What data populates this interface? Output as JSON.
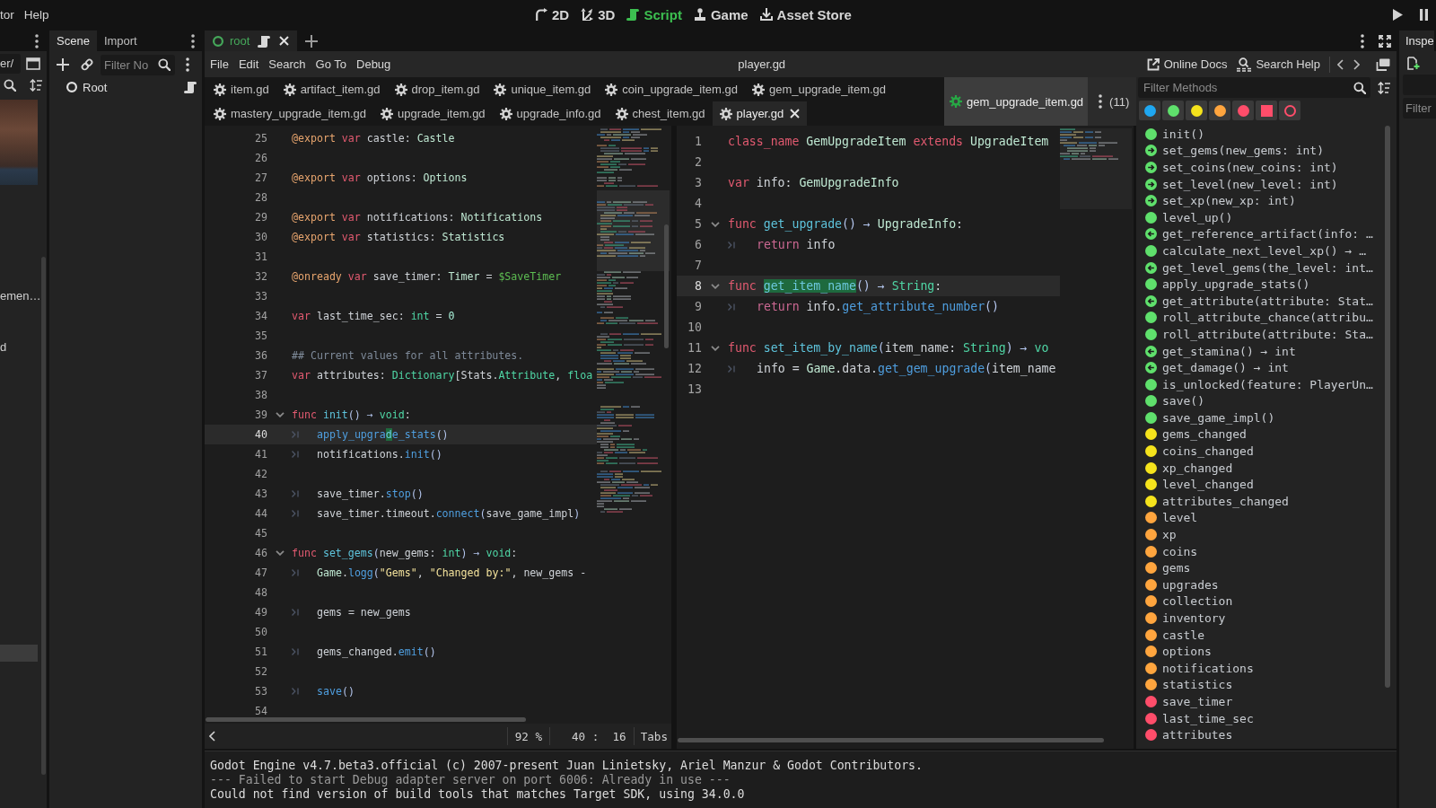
{
  "top_menu": [
    "tor",
    "Help"
  ],
  "workspaces": [
    {
      "label": "2D",
      "kind": "canvas",
      "selected": false
    },
    {
      "label": "3D",
      "kind": "spatial",
      "selected": false
    },
    {
      "label": "Script",
      "kind": "script",
      "selected": true
    },
    {
      "label": "Game",
      "kind": "game",
      "selected": false
    },
    {
      "label": "Asset Store",
      "kind": "store",
      "selected": false
    }
  ],
  "filesystem_dock": {
    "path": "er/",
    "items": [
      {
        "label": "emen…",
        "selected": false
      },
      {
        "label": "d",
        "selected": false
      },
      {
        "selected": true
      }
    ]
  },
  "scene_dock": {
    "tabs": [
      {
        "label": "Scene",
        "selected": true
      },
      {
        "label": "Import",
        "selected": false
      }
    ],
    "filter": {
      "placeholder": "Filter No"
    },
    "tree": [
      {
        "label": "Root",
        "has_script": true
      }
    ]
  },
  "script_editor": {
    "scene_tabs": [
      {
        "label": "root",
        "selected": true
      }
    ],
    "menu": [
      "File",
      "Edit",
      "Search",
      "Go To",
      "Debug"
    ],
    "current_file": "player.gd",
    "help_buttons": [
      {
        "label": "Online Docs",
        "kind": "docs"
      },
      {
        "label": "Search Help",
        "kind": "search"
      }
    ],
    "script_tab_rows": [
      {
        "tabs": [
          {
            "label": "item.gd",
            "selected": false
          },
          {
            "label": "artifact_item.gd",
            "selected": false
          },
          {
            "label": "drop_item.gd",
            "selected": false
          },
          {
            "label": "unique_item.gd",
            "selected": false
          },
          {
            "label": "coin_upgrade_item.gd",
            "selected": false
          },
          {
            "label": "gem_upgrade_item.gd",
            "selected": false
          }
        ]
      },
      {
        "tabs": [
          {
            "label": "mastery_upgrade_item.gd",
            "selected": false
          },
          {
            "label": "upgrade_item.gd",
            "selected": false
          },
          {
            "label": "upgrade_info.gd",
            "selected": false
          },
          {
            "label": "chest_item.gd",
            "selected": false
          },
          {
            "label": "player.gd",
            "selected": true
          }
        ]
      }
    ],
    "split_header": {
      "label": "gem_upgrade_item.gd",
      "count": "(11)"
    },
    "editors": [
      {
        "status": {
          "zoom": "92 %",
          "position": "40 :  16",
          "indentation": "Tabs"
        },
        "lines": [
          {
            "number": "25",
            "foldable": false,
            "indented": false,
            "current": false,
            "tokens": [
              {
                "kind": "annotation",
                "text": "@export "
              },
              {
                "kind": "keyword",
                "text": "var"
              },
              {
                "kind": "plain",
                "text": " castle: "
              },
              {
                "kind": "class",
                "text": "Castle"
              }
            ]
          },
          {
            "number": "26",
            "foldable": false,
            "indented": false,
            "current": false
          },
          {
            "number": "27",
            "foldable": false,
            "indented": false,
            "current": false,
            "tokens": [
              {
                "kind": "annotation",
                "text": "@export "
              },
              {
                "kind": "keyword",
                "text": "var"
              },
              {
                "kind": "plain",
                "text": " options: "
              },
              {
                "kind": "class",
                "text": "Options"
              }
            ]
          },
          {
            "number": "28",
            "foldable": false,
            "indented": false,
            "current": false
          },
          {
            "number": "29",
            "foldable": false,
            "indented": false,
            "current": false,
            "tokens": [
              {
                "kind": "annotation",
                "text": "@export "
              },
              {
                "kind": "keyword",
                "text": "var"
              },
              {
                "kind": "plain",
                "text": " notifications: "
              },
              {
                "kind": "class",
                "text": "Notifications"
              }
            ]
          },
          {
            "number": "30",
            "foldable": false,
            "indented": false,
            "current": false,
            "tokens": [
              {
                "kind": "annotation",
                "text": "@export "
              },
              {
                "kind": "keyword",
                "text": "var"
              },
              {
                "kind": "plain",
                "text": " statistics: "
              },
              {
                "kind": "class",
                "text": "Statistics"
              }
            ]
          },
          {
            "number": "31",
            "foldable": false,
            "indented": false,
            "current": false
          },
          {
            "number": "32",
            "foldable": false,
            "indented": false,
            "current": false,
            "tokens": [
              {
                "kind": "annotation",
                "text": "@onready "
              },
              {
                "kind": "keyword",
                "text": "var"
              },
              {
                "kind": "plain",
                "text": " save_timer: "
              },
              {
                "kind": "class",
                "text": "Timer"
              },
              {
                "kind": "plain",
                "text": " = "
              },
              {
                "kind": "nodepath",
                "text": "$SaveTimer"
              }
            ]
          },
          {
            "number": "33",
            "foldable": false,
            "indented": false,
            "current": false
          },
          {
            "number": "34",
            "foldable": false,
            "indented": false,
            "current": false,
            "tokens": [
              {
                "kind": "keyword",
                "text": "var"
              },
              {
                "kind": "plain",
                "text": " last_time_sec: "
              },
              {
                "kind": "type",
                "text": "int"
              },
              {
                "kind": "plain",
                "text": " = "
              },
              {
                "kind": "number",
                "text": "0"
              }
            ]
          },
          {
            "number": "35",
            "foldable": false,
            "indented": false,
            "current": false
          },
          {
            "number": "36",
            "foldable": false,
            "indented": false,
            "current": false,
            "tokens": [
              {
                "kind": "comment",
                "text": "## Current values for all attributes."
              }
            ]
          },
          {
            "number": "37",
            "foldable": false,
            "indented": false,
            "current": false,
            "tokens": [
              {
                "kind": "keyword",
                "text": "var"
              },
              {
                "kind": "plain",
                "text": " attributes: "
              },
              {
                "kind": "type",
                "text": "Dictionary"
              },
              {
                "kind": "plain",
                "text": "[Stats."
              },
              {
                "kind": "type",
                "text": "Attribute"
              },
              {
                "kind": "plain",
                "text": ", "
              },
              {
                "kind": "type",
                "text": "floa"
              }
            ]
          },
          {
            "number": "38",
            "foldable": false,
            "indented": false,
            "current": false
          },
          {
            "number": "39",
            "foldable": true,
            "indented": false,
            "current": false,
            "tokens": [
              {
                "kind": "keyword",
                "text": "func "
              },
              {
                "kind": "funcdef",
                "text": "init"
              },
              {
                "kind": "symbol",
                "text": "() → "
              },
              {
                "kind": "type",
                "text": "void"
              },
              {
                "kind": "plain",
                "text": ":"
              }
            ]
          },
          {
            "number": "40",
            "foldable": false,
            "indented": true,
            "current": true,
            "tokens": [
              {
                "kind": "call",
                "text": "apply_upgra"
              },
              {
                "kind": "selection",
                "text": "d"
              },
              {
                "kind": "call",
                "text": "e_stats"
              },
              {
                "kind": "symbol",
                "text": "()"
              }
            ]
          },
          {
            "number": "41",
            "foldable": false,
            "indented": true,
            "current": false,
            "tokens": [
              {
                "kind": "plain",
                "text": "notifications."
              },
              {
                "kind": "call",
                "text": "init"
              },
              {
                "kind": "symbol",
                "text": "()"
              }
            ]
          },
          {
            "number": "42",
            "foldable": false,
            "indented": false,
            "current": false
          },
          {
            "number": "43",
            "foldable": false,
            "indented": true,
            "current": false,
            "tokens": [
              {
                "kind": "plain",
                "text": "save_timer."
              },
              {
                "kind": "call",
                "text": "stop"
              },
              {
                "kind": "symbol",
                "text": "()"
              }
            ]
          },
          {
            "number": "44",
            "foldable": false,
            "indented": true,
            "current": false,
            "tokens": [
              {
                "kind": "plain",
                "text": "save_timer.timeout."
              },
              {
                "kind": "call",
                "text": "connect"
              },
              {
                "kind": "symbol",
                "text": "("
              },
              {
                "kind": "plain",
                "text": "save_game_impl"
              },
              {
                "kind": "symbol",
                "text": ")"
              }
            ]
          },
          {
            "number": "45",
            "foldable": false,
            "indented": false,
            "current": false
          },
          {
            "number": "46",
            "foldable": true,
            "indented": false,
            "current": false,
            "tokens": [
              {
                "kind": "keyword",
                "text": "func "
              },
              {
                "kind": "funcdef",
                "text": "set_gems"
              },
              {
                "kind": "symbol",
                "text": "("
              },
              {
                "kind": "plain",
                "text": "new_gems: "
              },
              {
                "kind": "type",
                "text": "int"
              },
              {
                "kind": "symbol",
                "text": ") → "
              },
              {
                "kind": "type",
                "text": "void"
              },
              {
                "kind": "plain",
                "text": ":"
              }
            ]
          },
          {
            "number": "47",
            "foldable": false,
            "indented": true,
            "current": false,
            "tokens": [
              {
                "kind": "class",
                "text": "Game"
              },
              {
                "kind": "plain",
                "text": "."
              },
              {
                "kind": "call",
                "text": "logg"
              },
              {
                "kind": "symbol",
                "text": "("
              },
              {
                "kind": "string",
                "text": "\"Gems\""
              },
              {
                "kind": "plain",
                "text": ", "
              },
              {
                "kind": "string",
                "text": "\"Changed by:\""
              },
              {
                "kind": "plain",
                "text": ", new_gems -"
              }
            ]
          },
          {
            "number": "48",
            "foldable": false,
            "indented": false,
            "current": false
          },
          {
            "number": "49",
            "foldable": false,
            "indented": true,
            "current": false,
            "tokens": [
              {
                "kind": "plain",
                "text": "gems = new_gems"
              }
            ]
          },
          {
            "number": "50",
            "foldable": false,
            "indented": false,
            "current": false
          },
          {
            "number": "51",
            "foldable": false,
            "indented": true,
            "current": false,
            "tokens": [
              {
                "kind": "plain",
                "text": "gems_changed."
              },
              {
                "kind": "call",
                "text": "emit"
              },
              {
                "kind": "symbol",
                "text": "()"
              }
            ]
          },
          {
            "number": "52",
            "foldable": false,
            "indented": false,
            "current": false
          },
          {
            "number": "53",
            "foldable": false,
            "indented": true,
            "current": false,
            "tokens": [
              {
                "kind": "call",
                "text": "save"
              },
              {
                "kind": "symbol",
                "text": "()"
              }
            ]
          },
          {
            "number": "54",
            "foldable": false,
            "indented": false,
            "current": false
          }
        ]
      },
      {
        "lines": [
          {
            "number": "1",
            "foldable": false,
            "indented": false,
            "current": false,
            "tokens": [
              {
                "kind": "keyword",
                "text": "class_name "
              },
              {
                "kind": "class",
                "text": "GemUpgradeItem "
              },
              {
                "kind": "keyword",
                "text": "extends "
              },
              {
                "kind": "class",
                "text": "UpgradeItem"
              }
            ]
          },
          {
            "number": "2",
            "foldable": false,
            "indented": false,
            "current": false
          },
          {
            "number": "3",
            "foldable": false,
            "indented": false,
            "current": false,
            "tokens": [
              {
                "kind": "keyword",
                "text": "var"
              },
              {
                "kind": "plain",
                "text": " info: "
              },
              {
                "kind": "class",
                "text": "GemUpgradeInfo"
              }
            ]
          },
          {
            "number": "4",
            "foldable": false,
            "indented": false,
            "current": false
          },
          {
            "number": "5",
            "foldable": true,
            "indented": false,
            "current": false,
            "tokens": [
              {
                "kind": "keyword",
                "text": "func "
              },
              {
                "kind": "funcdef",
                "text": "get_upgrade"
              },
              {
                "kind": "symbol",
                "text": "() → "
              },
              {
                "kind": "class",
                "text": "UpgradeInfo"
              },
              {
                "kind": "plain",
                "text": ":"
              }
            ]
          },
          {
            "number": "6",
            "foldable": false,
            "indented": true,
            "current": false,
            "tokens": [
              {
                "kind": "control",
                "text": "return"
              },
              {
                "kind": "plain",
                "text": " info"
              }
            ]
          },
          {
            "number": "7",
            "foldable": false,
            "indented": false,
            "current": false
          },
          {
            "number": "8",
            "foldable": true,
            "indented": false,
            "current": true,
            "tokens": [
              {
                "kind": "keyword",
                "text": "func "
              },
              {
                "kind": "selection",
                "text": "get_item_name"
              },
              {
                "kind": "symbol",
                "text": "() → "
              },
              {
                "kind": "type",
                "text": "String"
              },
              {
                "kind": "plain",
                "text": ":"
              }
            ]
          },
          {
            "number": "9",
            "foldable": false,
            "indented": true,
            "current": false,
            "tokens": [
              {
                "kind": "control",
                "text": "return"
              },
              {
                "kind": "plain",
                "text": " info."
              },
              {
                "kind": "call",
                "text": "get_attribute_number"
              },
              {
                "kind": "symbol",
                "text": "()"
              }
            ]
          },
          {
            "number": "10",
            "foldable": false,
            "indented": false,
            "current": false
          },
          {
            "number": "11",
            "foldable": true,
            "indented": false,
            "current": false,
            "tokens": [
              {
                "kind": "keyword",
                "text": "func "
              },
              {
                "kind": "funcdef",
                "text": "set_item_by_name"
              },
              {
                "kind": "symbol",
                "text": "("
              },
              {
                "kind": "plain",
                "text": "item_name: "
              },
              {
                "kind": "type",
                "text": "String"
              },
              {
                "kind": "symbol",
                "text": ") → "
              },
              {
                "kind": "type",
                "text": "vo"
              }
            ]
          },
          {
            "number": "12",
            "foldable": false,
            "indented": true,
            "current": false,
            "tokens": [
              {
                "kind": "plain",
                "text": "info = "
              },
              {
                "kind": "class",
                "text": "Game"
              },
              {
                "kind": "plain",
                "text": ".data."
              },
              {
                "kind": "call",
                "text": "get_gem_upgrade"
              },
              {
                "kind": "symbol",
                "text": "("
              },
              {
                "kind": "plain",
                "text": "item_name"
              }
            ]
          },
          {
            "number": "13",
            "foldable": false,
            "indented": false,
            "current": false
          }
        ]
      }
    ]
  },
  "methods_panel": {
    "filter": {
      "placeholder": "Filter Methods"
    },
    "type_filters": [
      {
        "kind": "dot",
        "color": "#1fa8f2"
      },
      {
        "kind": "dot",
        "color": "#5fe06c"
      },
      {
        "kind": "dot",
        "color": "#f5e31c"
      },
      {
        "kind": "dot",
        "color": "#ffa53e"
      },
      {
        "kind": "dot",
        "color": "#ff4d6a"
      },
      {
        "kind": "square",
        "color": "#ff4d6a"
      },
      {
        "kind": "ring",
        "color": "#ff4d6a"
      }
    ],
    "items": [
      {
        "label": "init()",
        "kind": "method"
      },
      {
        "label": "set_gems(new_gems: int)",
        "kind": "setter"
      },
      {
        "label": "set_coins(new_coins: int)",
        "kind": "setter"
      },
      {
        "label": "set_level(new_level: int)",
        "kind": "setter"
      },
      {
        "label": "set_xp(new_xp: int)",
        "kind": "setter"
      },
      {
        "label": "level_up()",
        "kind": "method"
      },
      {
        "label": "get_reference_artifact(info: …",
        "kind": "getter"
      },
      {
        "label": "calculate_next_level_xp() → …",
        "kind": "method"
      },
      {
        "label": "get_level_gems(the_level: int…",
        "kind": "getter"
      },
      {
        "label": "apply_upgrade_stats()",
        "kind": "method"
      },
      {
        "label": "get_attribute(attribute: Stat…",
        "kind": "getter"
      },
      {
        "label": "roll_attribute_chance(attribu…",
        "kind": "method"
      },
      {
        "label": "roll_attribute(attribute: Sta…",
        "kind": "method"
      },
      {
        "label": "get_stamina() → int",
        "kind": "getter"
      },
      {
        "label": "get_damage() → int",
        "kind": "getter"
      },
      {
        "label": "is_unlocked(feature: PlayerUn…",
        "kind": "method"
      },
      {
        "label": "save()",
        "kind": "method"
      },
      {
        "label": "save_game_impl()",
        "kind": "method"
      },
      {
        "label": "gems_changed",
        "kind": "signal"
      },
      {
        "label": "coins_changed",
        "kind": "signal"
      },
      {
        "label": "xp_changed",
        "kind": "signal"
      },
      {
        "label": "level_changed",
        "kind": "signal"
      },
      {
        "label": "attributes_changed",
        "kind": "signal"
      },
      {
        "label": "level",
        "kind": "exported"
      },
      {
        "label": "xp",
        "kind": "exported"
      },
      {
        "label": "coins",
        "kind": "exported"
      },
      {
        "label": "gems",
        "kind": "exported"
      },
      {
        "label": "upgrades",
        "kind": "exported"
      },
      {
        "label": "collection",
        "kind": "exported"
      },
      {
        "label": "inventory",
        "kind": "exported"
      },
      {
        "label": "castle",
        "kind": "exported"
      },
      {
        "label": "options",
        "kind": "exported"
      },
      {
        "label": "notifications",
        "kind": "exported"
      },
      {
        "label": "statistics",
        "kind": "exported"
      },
      {
        "label": "save_timer",
        "kind": "member"
      },
      {
        "label": "last_time_sec",
        "kind": "member"
      },
      {
        "label": "attributes",
        "kind": "member"
      }
    ]
  },
  "output": {
    "lines": [
      {
        "text": "Godot Engine v4.7.beta3.official (c) 2007-present Juan Linietsky, Ariel Manzur & Godot Contributors.",
        "kind": "normal"
      },
      {
        "text": "--- Failed to start Debug adapter server on port 6006: Already in use ---",
        "kind": "muted"
      },
      {
        "text": "Could not find version of build tools that matches Target SDK, using 34.0.0",
        "kind": "normal"
      }
    ]
  },
  "inspector": {
    "tab": {
      "label": "Inspe",
      "selected": true
    },
    "filter": {
      "placeholder": "Filter"
    }
  }
}
